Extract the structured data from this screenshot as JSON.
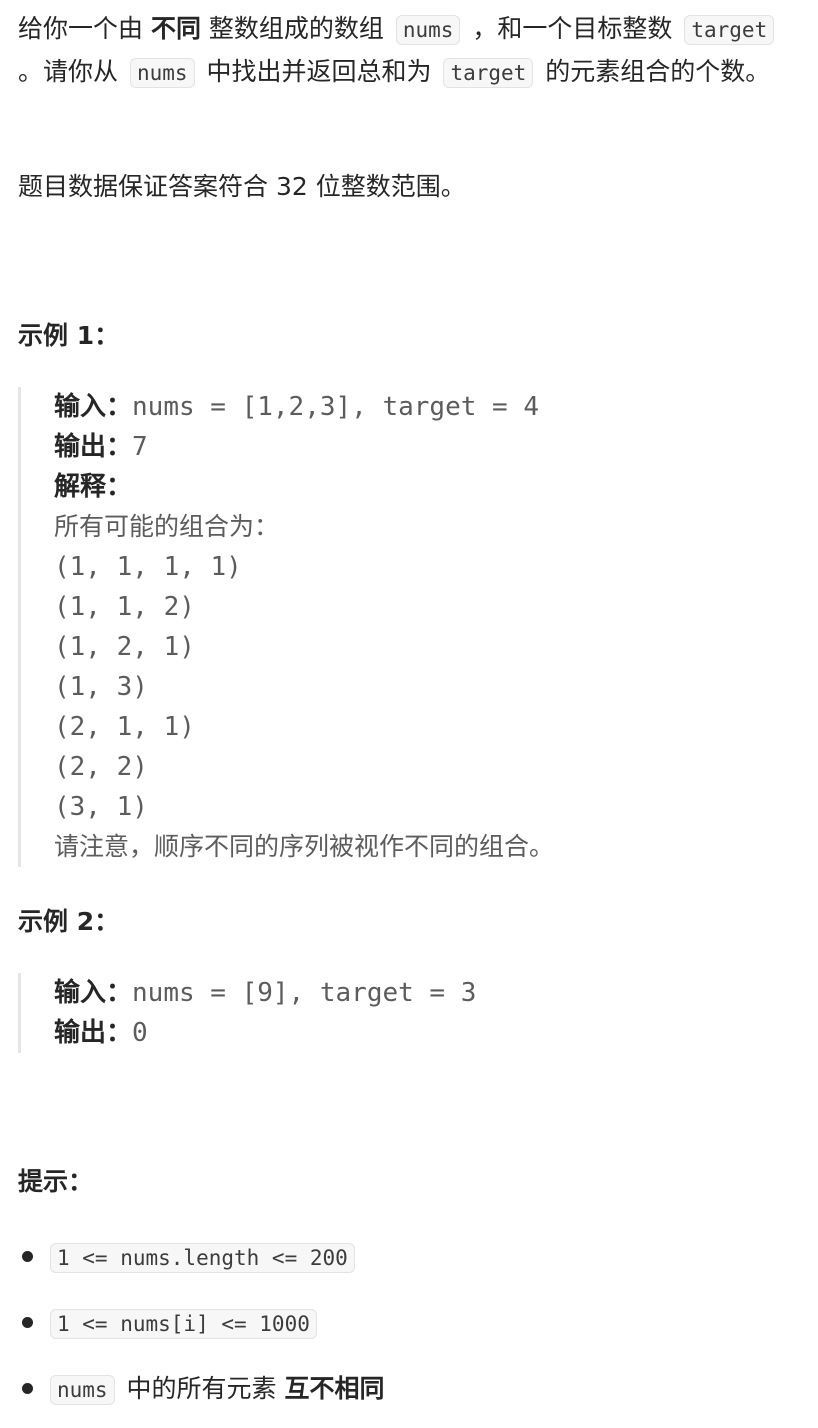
{
  "description": {
    "p1_part1": "给你一个由 ",
    "p1_bold": "不同",
    "p1_part2": " 整数组成的数组 ",
    "code_nums": "nums",
    "p1_part3": " ，和一个目标整数 ",
    "code_target": "target",
    "p1_part4": " 。请你从 ",
    "p1_part5": " 中找出并返回总和为 ",
    "p1_part6": " 的元素组合的个数。",
    "p2": "题目数据保证答案符合 32 位整数范围。"
  },
  "example1": {
    "heading": "示例 1：",
    "input_label": "输入：",
    "input_value": "nums = [1,2,3], target = 4",
    "output_label": "输出：",
    "output_value": "7",
    "explain_label": "解释：",
    "explain_intro": "所有可能的组合为：",
    "combos": [
      "(1, 1, 1, 1)",
      "(1, 1, 2)",
      "(1, 2, 1)",
      "(1, 3)",
      "(2, 1, 1)",
      "(2, 2)",
      "(3, 1)"
    ],
    "note": "请注意，顺序不同的序列被视作不同的组合。"
  },
  "example2": {
    "heading": "示例 2：",
    "input_label": "输入：",
    "input_value": "nums = [9], target = 3",
    "output_label": "输出：",
    "output_value": "0"
  },
  "hints": {
    "heading": "提示：",
    "item1_code": "1 <= nums.length <= 200",
    "item2_code": "1 <= nums[i] <= 1000",
    "item3_code": "nums",
    "item3_text": " 中的所有元素 ",
    "item3_bold": "互不相同"
  }
}
